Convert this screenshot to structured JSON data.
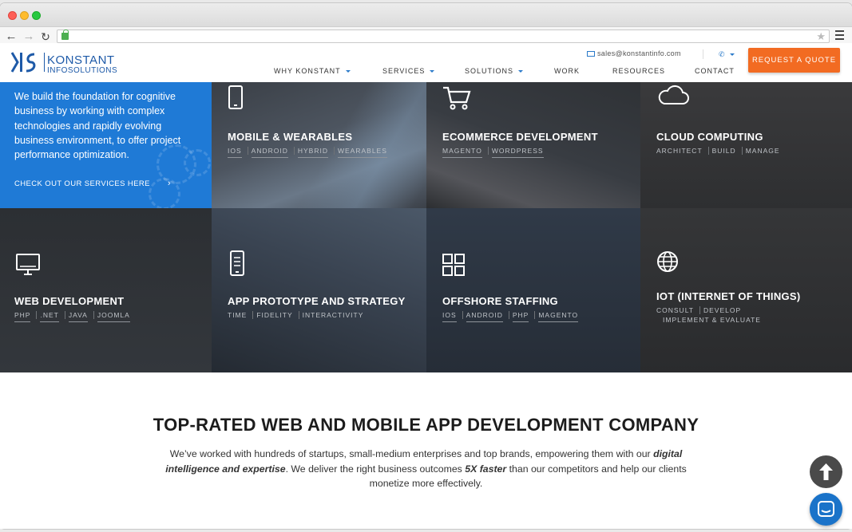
{
  "browser": {
    "url": ""
  },
  "header": {
    "logo_line1": "KONSTANT",
    "logo_line2": "INFOSOLUTIONS",
    "email": "sales@konstantinfo.com",
    "nav": [
      {
        "label": "WHY KONSTANT",
        "dropdown": true
      },
      {
        "label": "SERVICES",
        "dropdown": true
      },
      {
        "label": "SOLUTIONS",
        "dropdown": true
      },
      {
        "label": "WORK",
        "dropdown": false
      },
      {
        "label": "RESOURCES",
        "dropdown": false
      },
      {
        "label": "CONTACT",
        "dropdown": false
      }
    ],
    "quote_label": "REQUEST A QUOTE"
  },
  "intro": {
    "text": "We build the foundation for cognitive business by working with complex technologies and rapidly evolving business environment, to offer project performance optimization.",
    "link": "CHECK OUT OUR SERVICES HERE"
  },
  "tiles": [
    {
      "title": "MOBILE & WEARABLES",
      "icon": "mobile-icon",
      "tags": [
        "IOS",
        "ANDROID",
        "HYBRID",
        "WEARABLES"
      ]
    },
    {
      "title": "ECOMMERCE DEVELOPMENT",
      "icon": "cart-icon",
      "tags": [
        "MAGENTO",
        "WORDPRESS"
      ]
    },
    {
      "title": "CLOUD COMPUTING",
      "icon": "cloud-icon",
      "tags": [
        "ARCHITECT",
        "BUILD",
        "MANAGE"
      ]
    },
    {
      "title": "WEB DEVELOPMENT",
      "icon": "monitor-icon",
      "tags": [
        "PHP",
        ".NET",
        "JAVA",
        "JOOMLA"
      ]
    },
    {
      "title": "APP PROTOTYPE AND STRATEGY",
      "icon": "prototype-icon",
      "tags": [
        "TIME",
        "FIDELITY",
        "INTERACTIVITY"
      ]
    },
    {
      "title": "OFFSHORE STAFFING",
      "icon": "grid-icon",
      "tags": [
        "IOS",
        "ANDROID",
        "PHP",
        "MAGENTO"
      ]
    },
    {
      "title": "IOT (INTERNET OF THINGS)",
      "icon": "globe-icon",
      "tags": [
        "CONSULT",
        "DEVELOP"
      ],
      "tags2": [
        "IMPLEMENT & EVALUATE"
      ]
    }
  ],
  "content": {
    "headline": "TOP-RATED WEB AND MOBILE APP DEVELOPMENT COMPANY",
    "p1": "We’ve worked with hundreds of startups, small-medium enterprises and top brands, empowering them with our ",
    "p1_em": "digital intelligence and expertise",
    "p2": ". We deliver the right business outcomes ",
    "p2_em": "5X faster",
    "p3": " than our competitors and help our clients monetize more effectively."
  }
}
